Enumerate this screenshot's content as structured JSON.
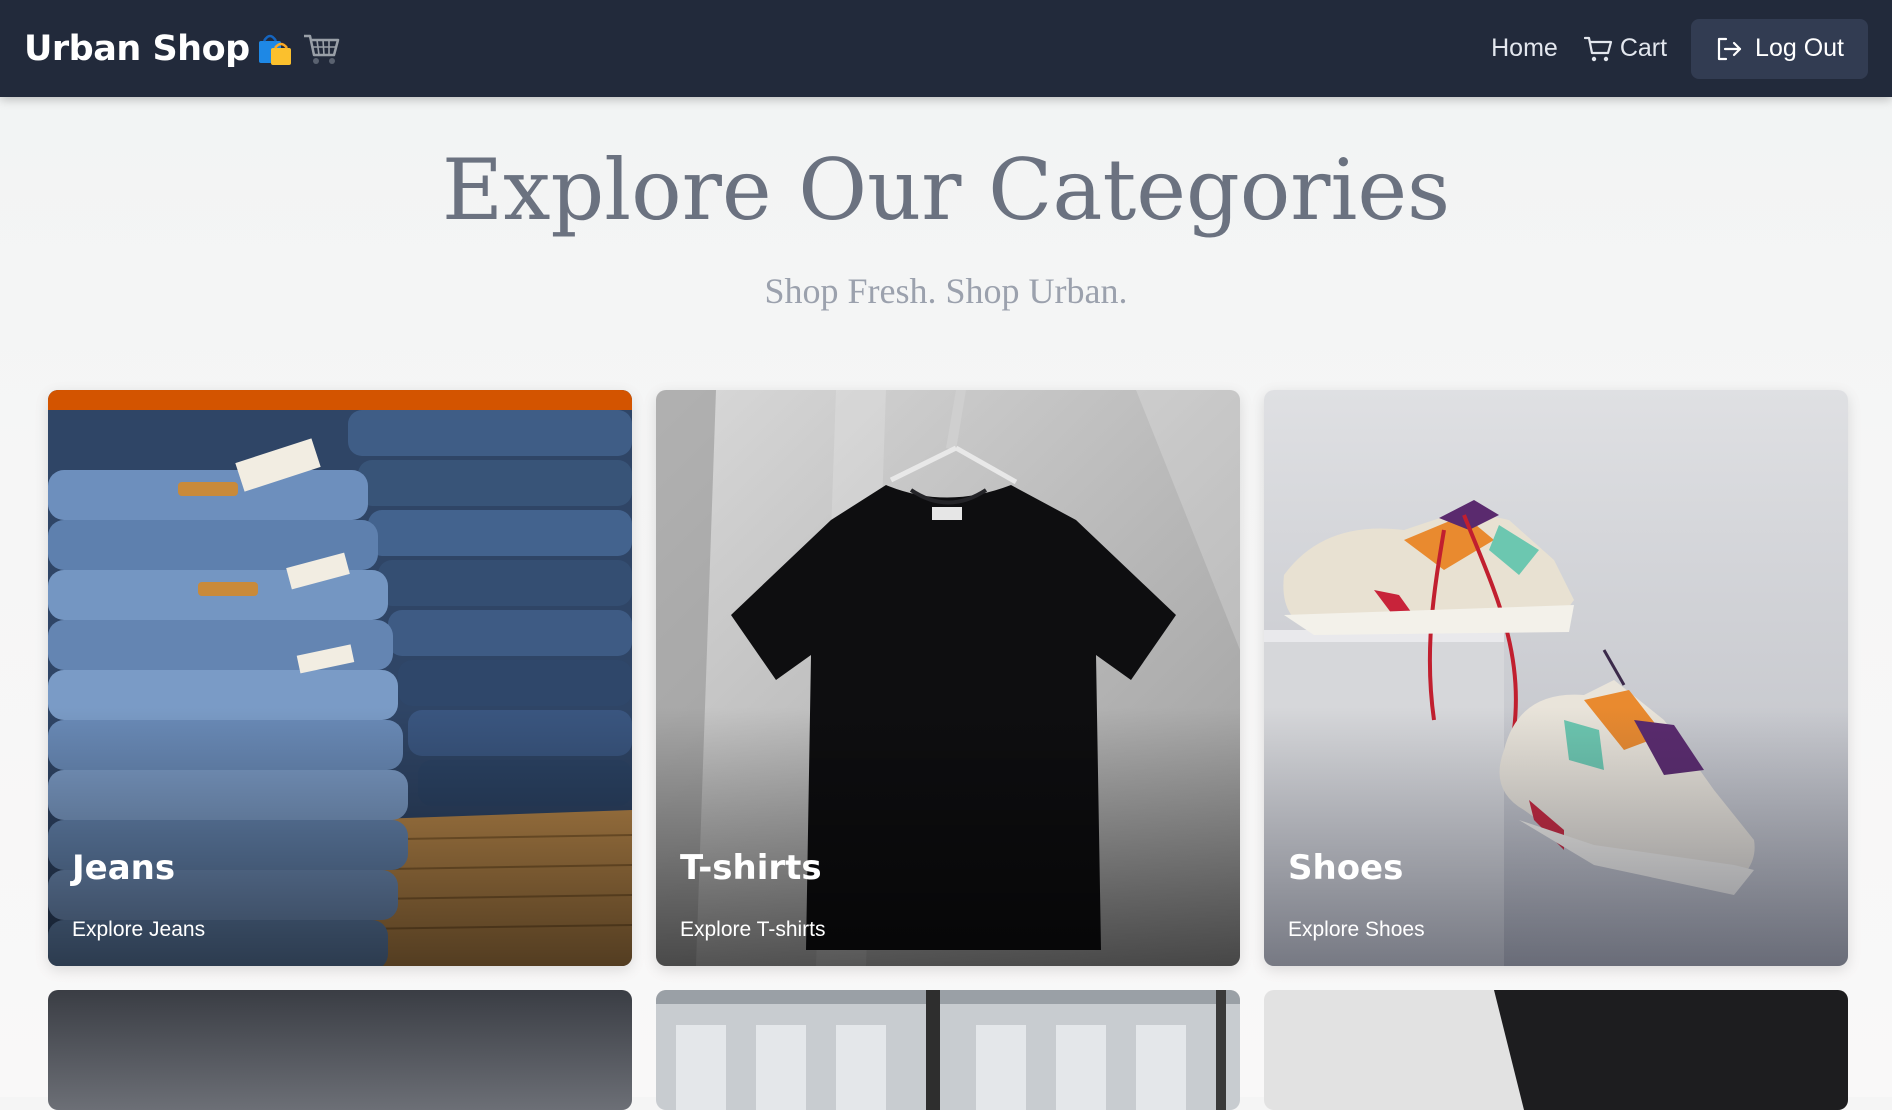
{
  "navbar": {
    "brand": "Urban Shop",
    "brand_icons": [
      "shopping-bags-icon",
      "shopping-cart-emoji-icon"
    ],
    "links": [
      {
        "label": "Home",
        "icon": ""
      },
      {
        "label": "Cart",
        "icon": "cart-icon"
      }
    ],
    "logout_label": "Log Out",
    "logout_icon": "logout-icon",
    "background": "#222a3b"
  },
  "hero": {
    "title": "Explore Our Categories",
    "subtitle": "Shop Fresh. Shop Urban."
  },
  "categories": [
    {
      "name": "Jeans",
      "cta": "Explore Jeans"
    },
    {
      "name": "T-shirts",
      "cta": "Explore T-shirts"
    },
    {
      "name": "Shoes",
      "cta": "Explore Shoes"
    }
  ],
  "colors": {
    "title": "#6b7280",
    "subtitle": "#9ba1ad",
    "logout_bg": "#323c52"
  }
}
